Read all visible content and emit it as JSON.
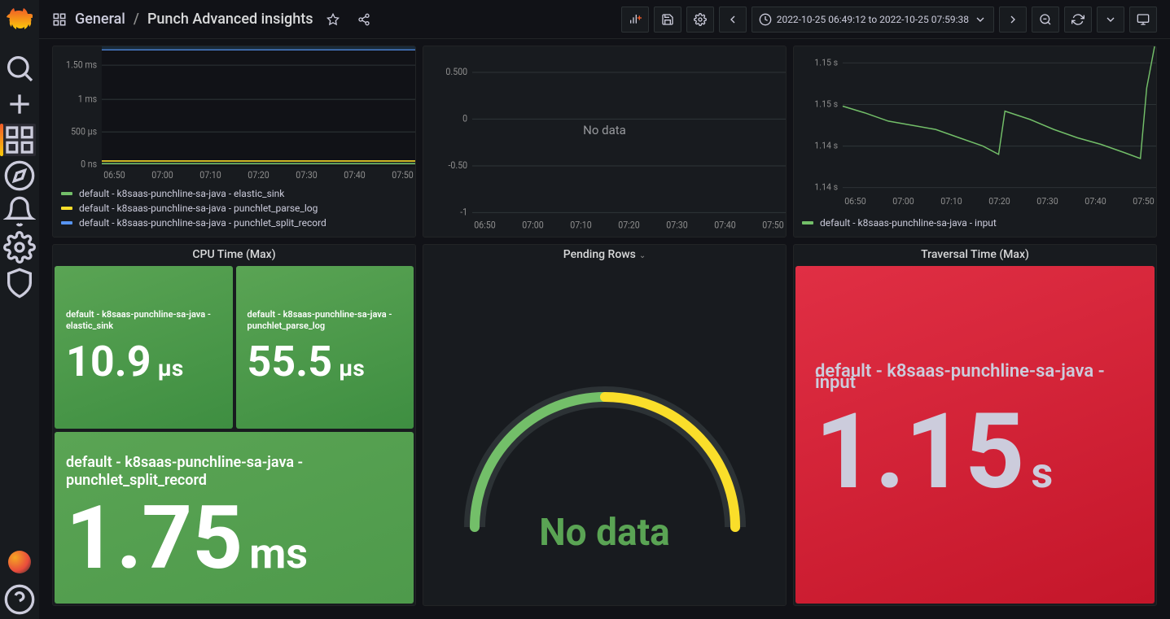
{
  "breadcrumb": {
    "folder": "General",
    "title": "Punch Advanced insights"
  },
  "time_range": "2022-10-25 06:49:12 to 2022-10-25 07:59:38",
  "top_row": {
    "panel1": {
      "y_ticks": [
        "1.50 ms",
        "1 ms",
        "500 µs",
        "0 ns"
      ],
      "x_ticks": [
        "06:50",
        "07:00",
        "07:10",
        "07:20",
        "07:30",
        "07:40",
        "07:50"
      ],
      "legend": [
        {
          "color": "#73BF69",
          "label": "default - k8saas-punchline-sa-java - elastic_sink"
        },
        {
          "color": "#FADE2A",
          "label": "default - k8saas-punchline-sa-java - punchlet_parse_log"
        },
        {
          "color": "#5794F2",
          "label": "default - k8saas-punchline-sa-java - punchlet_split_record"
        }
      ]
    },
    "panel2": {
      "y_ticks": [
        "0.500",
        "0",
        "-0.50",
        "-1"
      ],
      "x_ticks": [
        "06:50",
        "07:00",
        "07:10",
        "07:20",
        "07:30",
        "07:40",
        "07:50"
      ],
      "nodata": "No data"
    },
    "panel3": {
      "y_ticks": [
        "1.15 s",
        "1.15 s",
        "1.14 s",
        "1.14 s"
      ],
      "x_ticks": [
        "06:50",
        "07:00",
        "07:10",
        "07:20",
        "07:30",
        "07:40",
        "07:50"
      ],
      "legend": [
        {
          "color": "#73BF69",
          "label": "default - k8saas-punchline-sa-java - input"
        }
      ]
    }
  },
  "bottom_row": {
    "cpu": {
      "title": "CPU Time (Max)",
      "cells": [
        {
          "label": "default - k8saas-punchline-sa-java - elastic_sink",
          "num": "10.9",
          "unit": "µs"
        },
        {
          "label": "default - k8saas-punchline-sa-java - punchlet_parse_log",
          "num": "55.5",
          "unit": "µs"
        },
        {
          "label": "default - k8saas-punchline-sa-java - punchlet_split_record",
          "num": "1.75",
          "unit": "ms"
        }
      ]
    },
    "pending": {
      "title": "Pending Rows",
      "text": "No data"
    },
    "traversal": {
      "title": "Traversal Time (Max)",
      "label": "default - k8saas-punchline-sa-java - input",
      "num": "1.15",
      "unit": "s"
    }
  },
  "chart_data": [
    {
      "type": "line",
      "title": "",
      "x_ticks": [
        "06:50",
        "07:00",
        "07:10",
        "07:20",
        "07:30",
        "07:40",
        "07:50"
      ],
      "y_ticks_labels": [
        "0 ns",
        "500 µs",
        "1 ms",
        "1.50 ms"
      ],
      "ylim_us": [
        0,
        1500
      ],
      "series": [
        {
          "name": "default - k8saas-punchline-sa-java - elastic_sink",
          "color": "#73BF69",
          "approx_constant_us": 20
        },
        {
          "name": "default - k8saas-punchline-sa-java - punchlet_parse_log",
          "color": "#FADE2A",
          "approx_constant_us": 55
        },
        {
          "name": "default - k8saas-punchline-sa-java - punchlet_split_record",
          "color": "#5794F2",
          "approx_constant_us": 1750
        }
      ]
    },
    {
      "type": "line",
      "title": "",
      "x_ticks": [
        "06:50",
        "07:00",
        "07:10",
        "07:20",
        "07:30",
        "07:40",
        "07:50"
      ],
      "y_ticks": [
        -1,
        -0.5,
        0,
        0.5
      ],
      "ylim": [
        -1,
        0.5
      ],
      "series": [],
      "nodata": true
    },
    {
      "type": "line",
      "title": "",
      "x_ticks": [
        "06:50",
        "07:00",
        "07:10",
        "07:20",
        "07:30",
        "07:40",
        "07:50"
      ],
      "y_ticks_labels": [
        "1.14 s",
        "1.14 s",
        "1.15 s",
        "1.15 s"
      ],
      "ylim_s": [
        1.137,
        1.16
      ],
      "series": [
        {
          "name": "default - k8saas-punchline-sa-java - input",
          "color": "#73BF69",
          "x": [
            "06:50",
            "06:55",
            "07:00",
            "07:05",
            "07:10",
            "07:15",
            "07:20",
            "07:22",
            "07:25",
            "07:30",
            "07:35",
            "07:40",
            "07:45",
            "07:50",
            "07:55",
            "07:58",
            "07:59"
          ],
          "y_s": [
            1.151,
            1.149,
            1.147,
            1.146,
            1.145,
            1.143,
            1.141,
            1.14,
            1.148,
            1.146,
            1.144,
            1.142,
            1.141,
            1.14,
            1.139,
            1.153,
            1.16
          ]
        }
      ]
    }
  ]
}
